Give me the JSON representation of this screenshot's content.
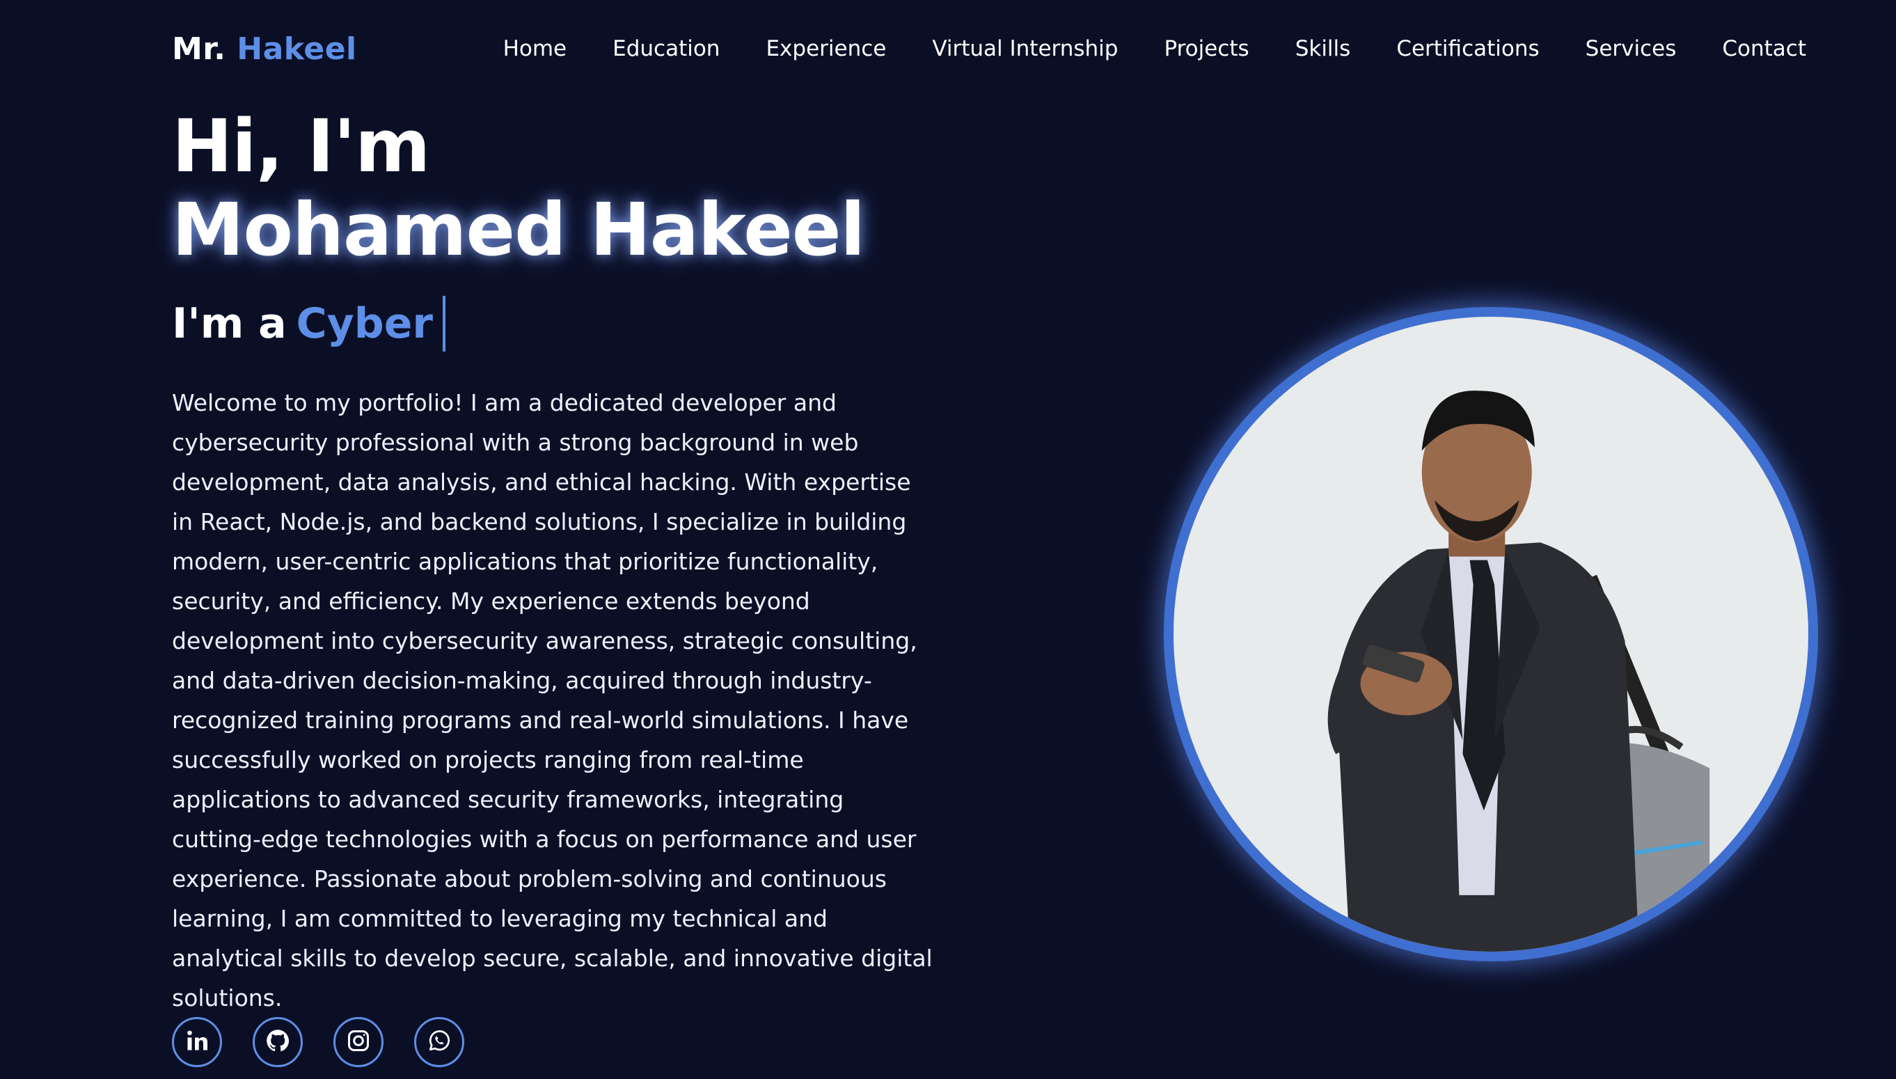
{
  "brand": {
    "prefix": "Mr.",
    "accent": "Hakeel"
  },
  "nav": {
    "items": [
      {
        "label": "Home"
      },
      {
        "label": "Education"
      },
      {
        "label": "Experience"
      },
      {
        "label": "Virtual Internship"
      },
      {
        "label": "Projects"
      },
      {
        "label": "Skills"
      },
      {
        "label": "Certifications"
      },
      {
        "label": "Services"
      },
      {
        "label": "Contact"
      }
    ]
  },
  "hero": {
    "greeting": "Hi, I'm",
    "name": "Mohamed Hakeel",
    "role_prefix": "I'm a",
    "role_typed": "Cyber",
    "bio": "Welcome to my portfolio! I am a dedicated developer and cybersecurity professional with a strong background in web development, data analysis, and ethical hacking. With expertise in React, Node.js, and backend solutions, I specialize in building modern, user-centric applications that prioritize functionality, security, and efficiency. My experience extends beyond development into cybersecurity awareness, strategic consulting, and data-driven decision-making, acquired through industry-recognized training programs and real-world simulations. I have successfully worked on projects ranging from real-time applications to advanced security frameworks, integrating cutting-edge technologies with a focus on performance and user experience. Passionate about problem-solving and continuous learning, I am committed to leveraging my technical and analytical skills to develop secure, scalable, and innovative digital solutions."
  },
  "socials": [
    {
      "icon": "linkedin-icon"
    },
    {
      "icon": "github-icon"
    },
    {
      "icon": "instagram-icon"
    },
    {
      "icon": "whatsapp-icon"
    }
  ],
  "colors": {
    "background": "#0b0f26",
    "accent": "#5d8fe6",
    "text": "#ffffff"
  }
}
